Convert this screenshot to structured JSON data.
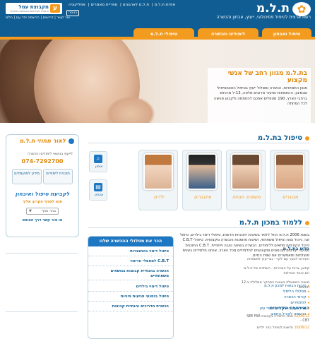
{
  "header": {
    "logo_text": "ת.ל.מ",
    "tagline": "רשת ארצית לטיפול פסיכולוגי, ייעוץ, אבחון והכשרה",
    "top_links": [
      "אודות ת.ל.מ",
      "ת.ל.מ לארגונים",
      "ספריית מאמרים",
      "אפליקציה"
    ],
    "partner_name": "מקבוצת עמל",
    "partner_badge": "ע",
    "partner_sub": "החברה לשירותים וטכנולוגיה חינוכית",
    "login_label": "כניסה",
    "sub_links": "צור קשר | דרושים | הרשמה יחד עם | כלים"
  },
  "nav": {
    "tabs": [
      "טיפול ואבחון",
      "לימודים והכשרה",
      "טיפולי ת.ל.מ"
    ]
  },
  "hero": {
    "title": "בת.ל.מ מגוון רחב של אנשי מקצוע",
    "text": "מגוון התמחויות, הכשרה ומסלול ייעוץ בטיפול האוטוטיפולי שבמיגון, ההתמחות ושיעור מרובים מלאה, 13-ל מרכזים ברחבי הארץ, 190 מטפלים אתכם להחתמה ולקבוע פגישה לכל המחתה"
  },
  "therapy": {
    "title": "טיפול בת.ל.מ",
    "tiles": [
      "מבוגרים",
      "משפחה וזוגיות",
      "מתבגרים",
      "ילדים"
    ],
    "small_tiles": [
      "אימון",
      "אבחון"
    ]
  },
  "widget": {
    "title": "לאור מחוזי ת.ל.מ",
    "line": "לייעוץ בנושאי לימודים והכשרה",
    "phone": "074-7292700",
    "btn_right": "תוכנית לימודים",
    "btn_left": "מידע למועמדים",
    "cta": "לקביעת טיפול ואיבחון",
    "sub": "פנה לסניף הקרוב אליך",
    "select": "בחר סניף",
    "bottom": "או צור קשר דרך הטופס"
  },
  "news": {
    "title": "חדש בת.ל.מ",
    "items": [
      "השירות לנוער עם לקוי - גם ייעוץ למשפחה",
      "קפטן, צרות על הבכירות - השתדמ של ת.ל.מ הם איגוד הגדולות",
      "משנה הממשלת בשיטת המחקר ממלולה ב-12 תחומים"
    ],
    "events_title": "האירועים הקרובים",
    "events": [
      {
        "date": "02/06/12",
        "text": "תנאי הלמידה בקבוצת SEE FAR CBT -"
      },
      {
        "date": "10/06/12",
        "text": "חדשות לטיפול בחר ילדים"
      }
    ]
  },
  "study": {
    "title": "ללמוד במכון ת.ל.מ",
    "text": "בשנת 2006 ת.ל.מ החל ללמד בשיטות חינוכיות חדשות, טיפולי דימוי בילדים, טיפול זוגי, ניהול צוות וטיפול משפחתי, ושיטות מוזמנות והכשרה מקצועית. טיפולי C.B.T ניהול הקורסים מתאים ללימודים, הכשרה בשיטה טובה וייחודית. C.B.T התוכנית מציעה קורסים מבוססים ומקצועיים לתלמידים מכל הארץ. אנחנו תלמידים בשנים מוצלחות ומאפשרים את שפת החיים.",
    "links": [
      "סיבות הבאות למכון ת.ל.מ",
      "מסלולי הלימוד",
      "קורסי הכשרה",
      "לתלמידים",
      "הרצאות, השתלמויות וימי עיון",
      "הרשמה לקורל התחוב"
    ]
  },
  "programs": {
    "head": "הכר את מסלולי ההכשרה שלנו",
    "items": [
      "טיפול דימוי בהתבגרות",
      "C.B.T למטפלי הדימוי",
      "הכשרה בהנחיית קבוצות בנושאים משפחתיים",
      "טיפול דימוי בילדים",
      "טיפול בנפגעי פגיעות מיניות",
      "הכשרת מדריכים והנחיית קבוצות"
    ]
  }
}
